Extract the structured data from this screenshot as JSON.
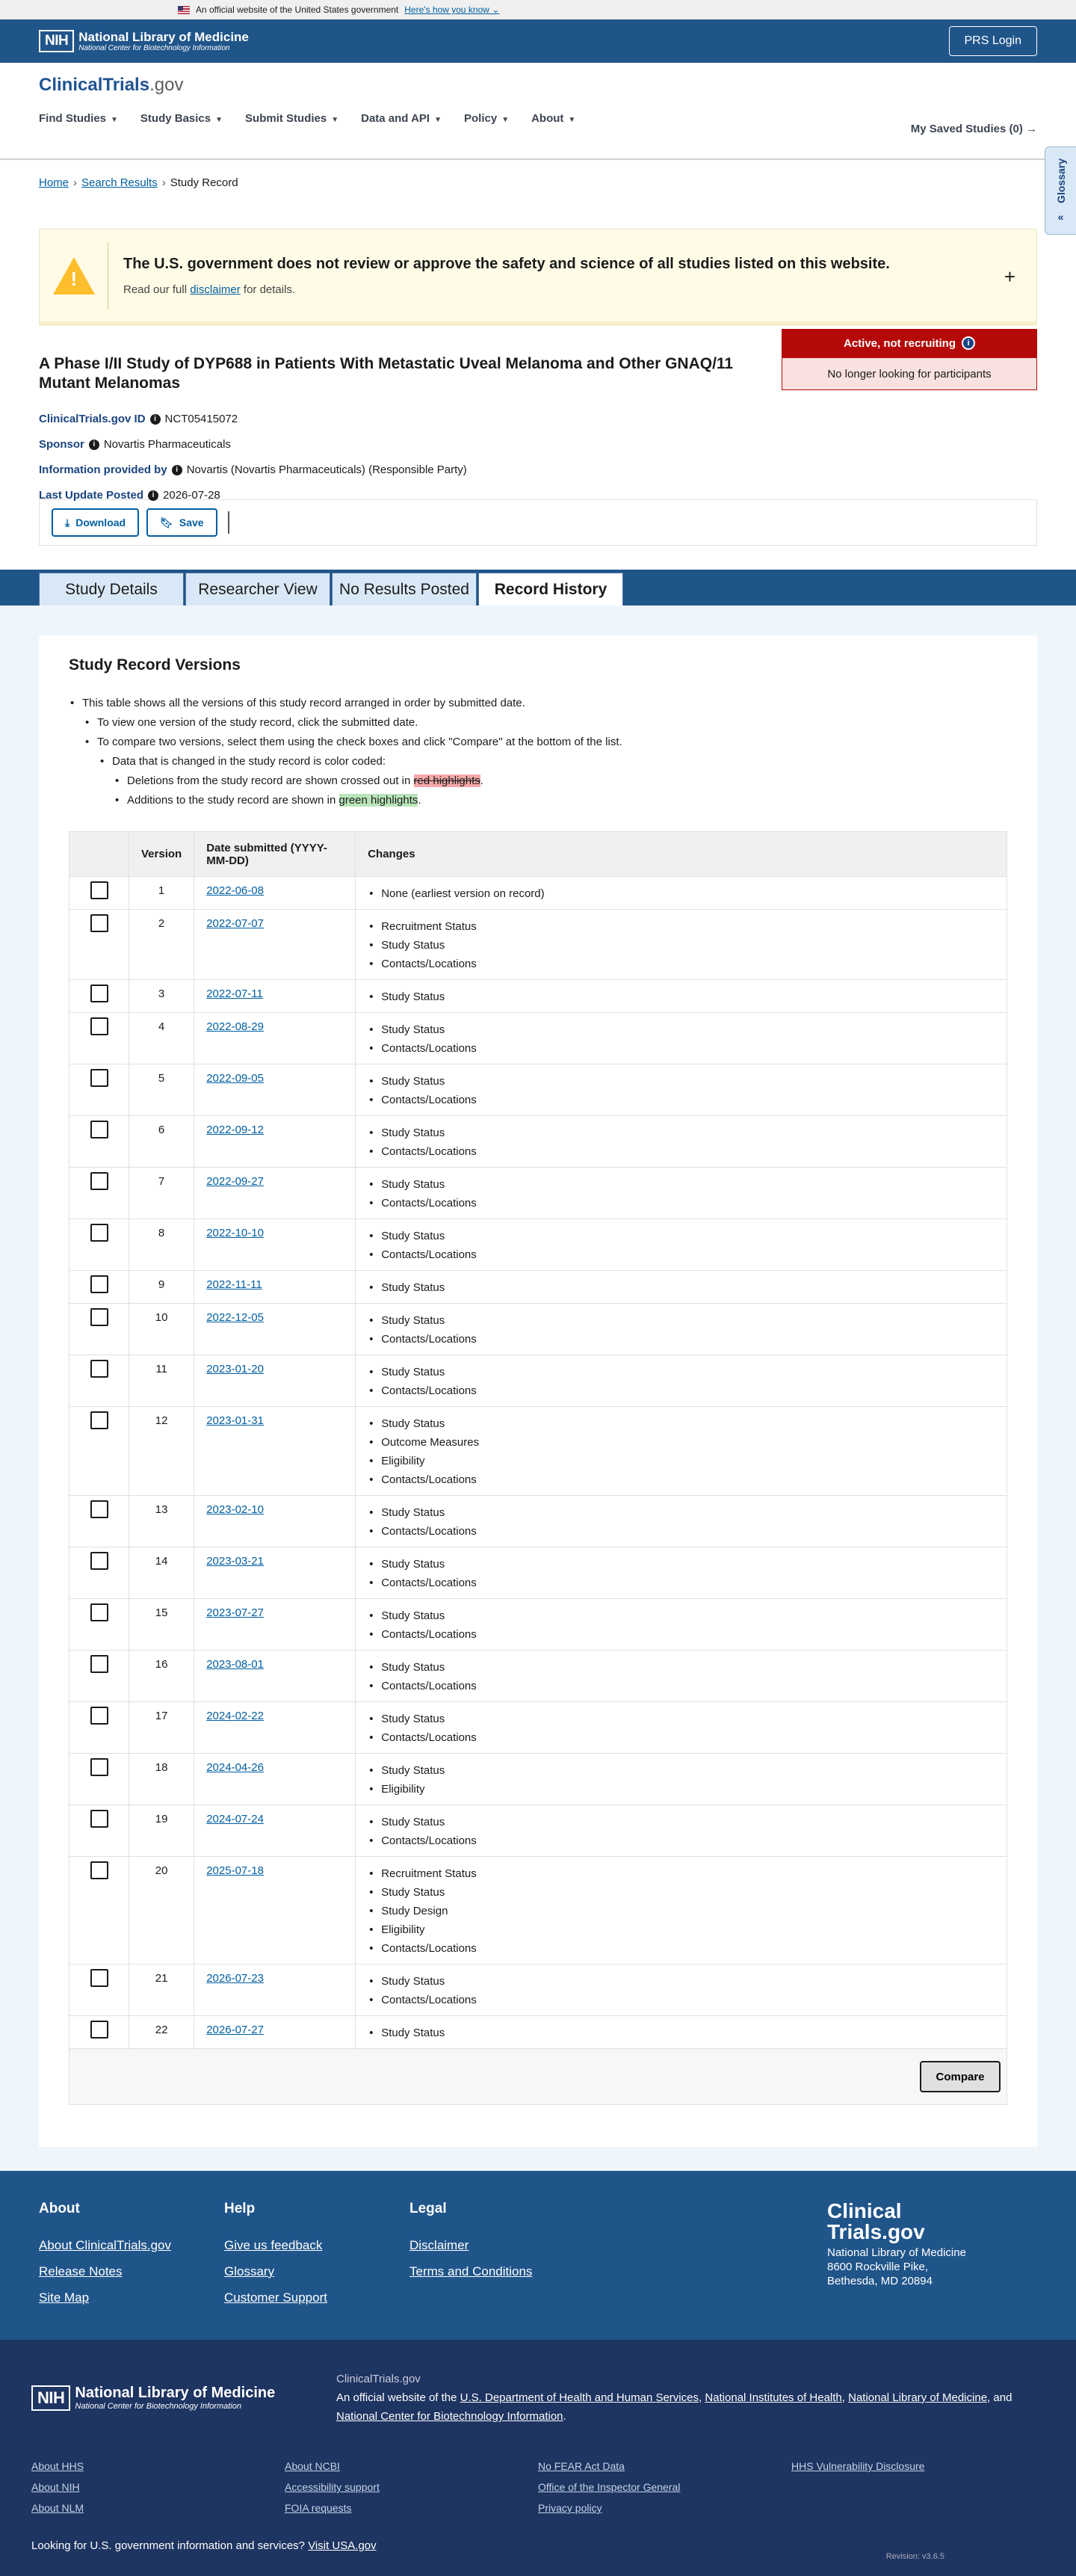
{
  "gov_banner": {
    "text": "An official website of the United States government",
    "how": "Here's how you know"
  },
  "nih": {
    "logo": "NIH",
    "name": "National Library of Medicine",
    "sub": "National Center for Biotechnology Information",
    "prs": "PRS Login"
  },
  "ct": {
    "brand": "ClinicalTrials",
    "brand_dot": ".gov",
    "nav": [
      "Find Studies",
      "Study Basics",
      "Submit Studies",
      "Data and API",
      "Policy",
      "About"
    ],
    "saved": "My Saved Studies (0)"
  },
  "breadcrumb": {
    "home": "Home",
    "search": "Search Results",
    "current": "Study Record"
  },
  "glossary": "Glossary",
  "disclaimer": {
    "title": "The U.S. government does not review or approve the safety and science of all studies listed on this website.",
    "pre": "Read our full ",
    "link": "disclaimer",
    "post": " for details."
  },
  "study": {
    "title": "A Phase I/II Study of DYP688 in Patients With Metastatic Uveal Melanoma and Other GNAQ/11 Mutant Melanomas",
    "id_label": "ClinicalTrials.gov ID",
    "id": "NCT05415072",
    "sponsor_label": "Sponsor",
    "sponsor": "Novartis Pharmaceuticals",
    "info_label": "Information provided by",
    "info": "Novartis (Novartis Pharmaceuticals) (Responsible Party)",
    "updated_label": "Last Update Posted",
    "updated": "2026-07-28",
    "status": "Active, not recruiting",
    "status_sub": "No longer looking for participants"
  },
  "toolbar": {
    "download": "Download",
    "save": "Save"
  },
  "tabs": [
    "Study Details",
    "Researcher View",
    "No Results Posted",
    "Record History"
  ],
  "versions": {
    "title": "Study Record Versions",
    "b1": "This table shows all the versions of this study record arranged in order by submitted date.",
    "b2": "To view one version of the study record, click the submitted date.",
    "b3": "To compare two versions, select them using the check boxes and click \"Compare\" at the bottom of the list.",
    "b4": "Data that is changed in the study record is color coded:",
    "b5_pre": "Deletions from the study record are shown crossed out in ",
    "b5_mark": "red highlights",
    "b5_post": ".",
    "b6_pre": "Additions to the study record are shown in ",
    "b6_mark": "green highlights",
    "b6_post": ".",
    "headers": [
      "Version",
      "Date submitted (YYYY-MM-DD)",
      "Changes"
    ],
    "rows": [
      {
        "v": "1",
        "d": "2022-06-08",
        "c": [
          "None (earliest version on record)"
        ]
      },
      {
        "v": "2",
        "d": "2022-07-07",
        "c": [
          "Recruitment Status",
          "Study Status",
          "Contacts/Locations"
        ]
      },
      {
        "v": "3",
        "d": "2022-07-11",
        "c": [
          "Study Status"
        ]
      },
      {
        "v": "4",
        "d": "2022-08-29",
        "c": [
          "Study Status",
          "Contacts/Locations"
        ]
      },
      {
        "v": "5",
        "d": "2022-09-05",
        "c": [
          "Study Status",
          "Contacts/Locations"
        ]
      },
      {
        "v": "6",
        "d": "2022-09-12",
        "c": [
          "Study Status",
          "Contacts/Locations"
        ]
      },
      {
        "v": "7",
        "d": "2022-09-27",
        "c": [
          "Study Status",
          "Contacts/Locations"
        ]
      },
      {
        "v": "8",
        "d": "2022-10-10",
        "c": [
          "Study Status",
          "Contacts/Locations"
        ]
      },
      {
        "v": "9",
        "d": "2022-11-11",
        "c": [
          "Study Status"
        ]
      },
      {
        "v": "10",
        "d": "2022-12-05",
        "c": [
          "Study Status",
          "Contacts/Locations"
        ]
      },
      {
        "v": "11",
        "d": "2023-01-20",
        "c": [
          "Study Status",
          "Contacts/Locations"
        ]
      },
      {
        "v": "12",
        "d": "2023-01-31",
        "c": [
          "Study Status",
          "Outcome Measures",
          "Eligibility",
          "Contacts/Locations"
        ]
      },
      {
        "v": "13",
        "d": "2023-02-10",
        "c": [
          "Study Status",
          "Contacts/Locations"
        ]
      },
      {
        "v": "14",
        "d": "2023-03-21",
        "c": [
          "Study Status",
          "Contacts/Locations"
        ]
      },
      {
        "v": "15",
        "d": "2023-07-27",
        "c": [
          "Study Status",
          "Contacts/Locations"
        ]
      },
      {
        "v": "16",
        "d": "2023-08-01",
        "c": [
          "Study Status",
          "Contacts/Locations"
        ]
      },
      {
        "v": "17",
        "d": "2024-02-22",
        "c": [
          "Study Status",
          "Contacts/Locations"
        ]
      },
      {
        "v": "18",
        "d": "2024-04-26",
        "c": [
          "Study Status",
          "Eligibility"
        ]
      },
      {
        "v": "19",
        "d": "2024-07-24",
        "c": [
          "Study Status",
          "Contacts/Locations"
        ]
      },
      {
        "v": "20",
        "d": "2025-07-18",
        "c": [
          "Recruitment Status",
          "Study Status",
          "Study Design",
          "Eligibility",
          "Contacts/Locations"
        ]
      },
      {
        "v": "21",
        "d": "2026-07-23",
        "c": [
          "Study Status",
          "Contacts/Locations"
        ]
      },
      {
        "v": "22",
        "d": "2026-07-27",
        "c": [
          "Study Status"
        ]
      }
    ],
    "compare": "Compare"
  },
  "footer": {
    "cols": [
      {
        "h": "About",
        "links": [
          "About ClinicalTrials.gov",
          "Release Notes",
          "Site Map"
        ]
      },
      {
        "h": "Help",
        "links": [
          "Give us feedback",
          "Glossary",
          "Customer Support"
        ]
      },
      {
        "h": "Legal",
        "links": [
          "Disclaimer",
          "Terms and Conditions"
        ]
      }
    ],
    "brand1": "Clinical",
    "brand2": "Trials.gov",
    "org": "National Library of Medicine",
    "addr": "8600 Rockville Pike, Bethesda, MD 20894",
    "site": "ClinicalTrials.gov",
    "official_pre": "An official website of the ",
    "hhs": "U.S. Department of Health and Human Services",
    "nih_l": "National Institutes of Health",
    "nlm_l": "National Library of Medicine",
    "and": "and ",
    "ncbi_l": "National Center for Biotechnology Information",
    "links": [
      [
        "About HHS",
        "About NIH",
        "About NLM"
      ],
      [
        "About NCBI",
        "Accessibility support",
        "FOIA requests"
      ],
      [
        "No FEAR Act Data",
        "Office of the Inspector General",
        "Privacy policy"
      ],
      [
        "HHS Vulnerability Disclosure"
      ]
    ],
    "usa_pre": "Looking for U.S. government information and services?",
    "usa_link": "Visit USA.gov",
    "revision": "Revision: v3.6.5"
  }
}
